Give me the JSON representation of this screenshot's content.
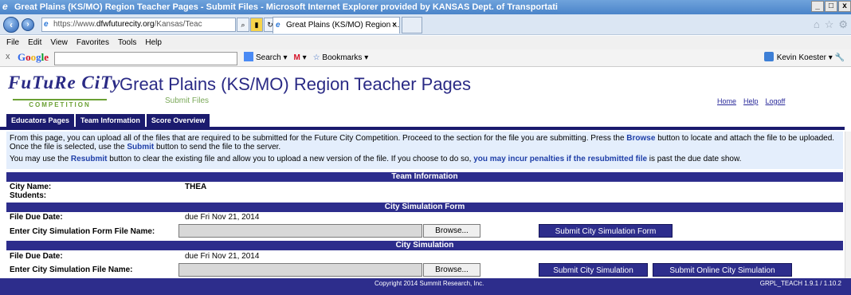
{
  "window": {
    "title": "Great Plains (KS/MO) Region Teacher Pages - Submit Files - Microsoft Internet Explorer provided by KANSAS Dept. of Transportati",
    "controls": [
      "_",
      "□",
      "x"
    ]
  },
  "browser": {
    "address_prefix": "https://www.",
    "address_domain": "dfwfuturecity.org",
    "address_rest": "/Kansas/Teac",
    "tab_title": "Great Plains (KS/MO) Region ...",
    "tab_close": "×"
  },
  "menu": [
    "File",
    "Edit",
    "View",
    "Favorites",
    "Tools",
    "Help"
  ],
  "google_toolbar": {
    "logo": "Google",
    "search_label": "Search",
    "mail_label": "M",
    "bookmarks_label": "Bookmarks",
    "user": "Kevin Koester"
  },
  "site": {
    "logo_text": "FuTuRe CiTy",
    "logo_sub": "COMPETITION",
    "page_title": "Great Plains (KS/MO) Region Teacher Pages",
    "page_subtitle": "Submit Files",
    "links": [
      "Home",
      "Help",
      "Logoff"
    ],
    "tabs": [
      "Educators Pages",
      "Team Information",
      "Score Overview"
    ]
  },
  "info": {
    "p1_a": "From this page, you can upload all of the files that are required to be submitted for the Future City Competition. Proceed to the section for the file you are submitting. Press the ",
    "p1_b": "Browse",
    "p1_c": " button to locate and attach the file to be uploaded. Once the file is selected, use the ",
    "p1_d": "Submit",
    "p1_e": " button to send the file to the server.",
    "p2_a": "You may use the ",
    "p2_b": "Resubmit",
    "p2_c": " button to clear the existing file and allow you to upload a new version of the file. If you choose to do so, ",
    "p2_d": "you may incur penalties if the resubmitted file",
    "p2_e": " is past the due date show."
  },
  "team_info": {
    "header": "Team Information",
    "city_label": "City Name:",
    "city_value": "THEA",
    "students_label": "Students:"
  },
  "sim_form": {
    "header": "City Simulation Form",
    "due_label": "File Due Date:",
    "due_value": "due Fri Nov 21, 2014",
    "file_label": "Enter City Simulation Form File Name:",
    "browse": "Browse...",
    "submit": "Submit City Simulation Form"
  },
  "sim": {
    "header": "City Simulation",
    "due_label": "File Due Date:",
    "due_value": "due Fri Nov 21, 2014",
    "file_label": "Enter City Simulation File Name:",
    "browse": "Browse...",
    "submit": "Submit City Simulation",
    "submit_online": "Submit Online City Simulation"
  },
  "footer": {
    "copyright": "Copyright 2014 Summit Research, Inc.",
    "version": "GRPL_TEACH 1.9.1 / 1.10.2"
  }
}
